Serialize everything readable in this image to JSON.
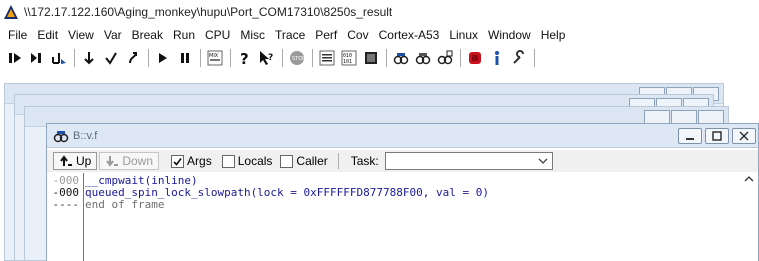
{
  "window": {
    "title": "\\\\172.17.122.160\\Aging_monkey\\hupu\\Port_COM17310\\8250s_result"
  },
  "menu": [
    "File",
    "Edit",
    "View",
    "Var",
    "Break",
    "Run",
    "CPU",
    "Misc",
    "Trace",
    "Perf",
    "Cov",
    "Cortex-A53",
    "Linux",
    "Window",
    "Help"
  ],
  "toolbar_icons": [
    "step-over-icon",
    "step-into-icon",
    "step-up-icon",
    "step-down-icon",
    "return-icon",
    "up-icon",
    "go-icon",
    "break-icon",
    "mode-icon",
    "help-icon",
    "context-help-icon",
    "stop-icon",
    "list-icon",
    "memory-icon",
    "registers-icon",
    "var-watch-icon",
    "var-local-icon",
    "var-view-icon",
    "stack-icon",
    "info-icon",
    "settings-icon"
  ],
  "stack_window": {
    "title": "B::v.f",
    "buttons": {
      "up": "Up",
      "down": "Down"
    },
    "checkboxes": {
      "args": "Args",
      "locals": "Locals",
      "caller": "Caller"
    },
    "args_checked": true,
    "locals_checked": false,
    "caller_checked": false,
    "task_label": "Task:",
    "task_value": "",
    "frames": [
      {
        "level": "-000",
        "text": "__cmpwait(inline)"
      },
      {
        "level": "-000",
        "text": "queued_spin_lock_slowpath(lock = 0xFFFFFFD877788F00, val = 0)"
      },
      {
        "level": "----",
        "text": "end of frame"
      }
    ]
  },
  "colors": {
    "code_text": "#1a1a9c",
    "end_frame": "#6f6f6f",
    "window_frame": "#8fa7c0",
    "title_fill": "#dde8f4"
  }
}
